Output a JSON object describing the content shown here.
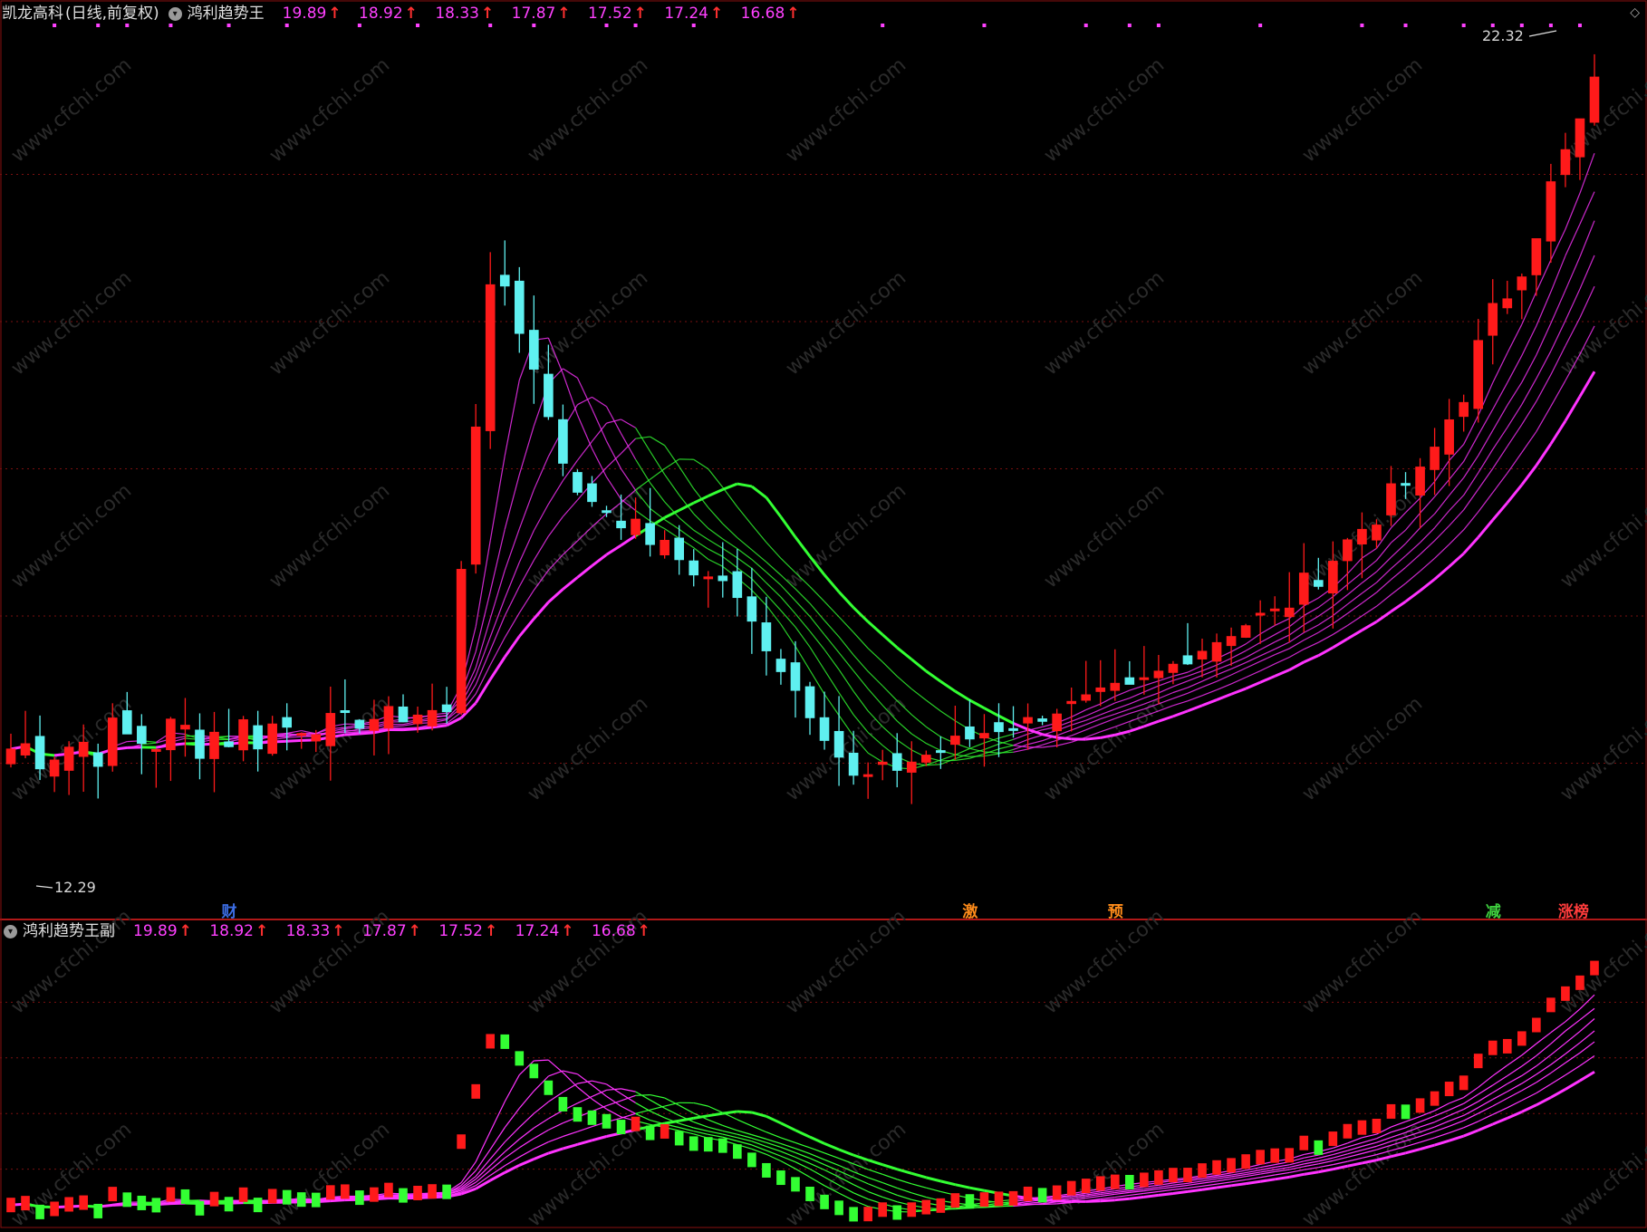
{
  "main_panel": {
    "stock_name": "凯龙高科",
    "period_label": "(日线,前复权)",
    "indicator_name": "鸿利趋势王",
    "values": [
      {
        "value": "19.89",
        "arrow": "↑"
      },
      {
        "value": "18.92",
        "arrow": "↑"
      },
      {
        "value": "18.33",
        "arrow": "↑"
      },
      {
        "value": "17.87",
        "arrow": "↑"
      },
      {
        "value": "17.52",
        "arrow": "↑"
      },
      {
        "value": "17.24",
        "arrow": "↑"
      },
      {
        "value": "16.68",
        "arrow": "↑"
      }
    ],
    "high_label": "22.32",
    "low_label": "12.29",
    "price_range": [
      11.2,
      23.2
    ]
  },
  "sub_panel": {
    "indicator_name": "鸿利趋势王副",
    "values": [
      {
        "value": "19.89",
        "arrow": "↑"
      },
      {
        "value": "18.92",
        "arrow": "↑"
      },
      {
        "value": "18.33",
        "arrow": "↑"
      },
      {
        "value": "17.87",
        "arrow": "↑"
      },
      {
        "value": "17.52",
        "arrow": "↑"
      },
      {
        "value": "17.24",
        "arrow": "↑"
      },
      {
        "value": "16.68",
        "arrow": "↑"
      }
    ]
  },
  "signal_markers": [
    {
      "text": "财",
      "bar": 15,
      "color": "#3c6ee6"
    },
    {
      "text": "激",
      "bar": 66,
      "color": "#ff8c1a"
    },
    {
      "text": "预",
      "bar": 76,
      "color": "#ff8c1a"
    },
    {
      "text": "减",
      "bar": 102,
      "color": "#3fd23f"
    },
    {
      "text": "涨榜",
      "bar": 107,
      "color": "#ff3c3c"
    }
  ],
  "watermark": "www.cfchi.com",
  "colors": {
    "up_candle": "#ff1a1a",
    "down_candle": "#5ff0f0",
    "bull_ribbon": "#ff33ff",
    "bear_ribbon": "#33ff33",
    "grid": "#7a1010",
    "indicator_value": "#ff40ff"
  },
  "chart_data": {
    "type": "candlestick",
    "bars": 110,
    "segments": [
      {
        "count": 20,
        "from": 13.4,
        "to": 13.7,
        "wiggle": 0.8
      },
      {
        "count": 10,
        "from": 13.7,
        "to": 13.9,
        "wiggle": 0.3
      },
      {
        "count": 4,
        "from": 13.9,
        "to": 19.7,
        "wiggle": 0.0
      },
      {
        "count": 6,
        "from": 19.7,
        "to": 16.8,
        "wiggle": 0.3
      },
      {
        "count": 9,
        "from": 16.8,
        "to": 15.7,
        "wiggle": 0.3
      },
      {
        "count": 10,
        "from": 15.7,
        "to": 13.0,
        "wiggle": 0.2
      },
      {
        "count": 10,
        "from": 13.0,
        "to": 13.7,
        "wiggle": 0.3
      },
      {
        "count": 8,
        "from": 13.7,
        "to": 14.2,
        "wiggle": 0.2
      },
      {
        "count": 10,
        "from": 14.2,
        "to": 15.2,
        "wiggle": 0.2
      },
      {
        "count": 10,
        "from": 15.2,
        "to": 17.0,
        "wiggle": 0.4
      },
      {
        "count": 13,
        "from": 17.0,
        "to": 22.3,
        "wiggle": 0.6
      }
    ],
    "ma_periods": [
      5,
      7,
      9,
      11,
      13,
      16,
      20
    ]
  }
}
